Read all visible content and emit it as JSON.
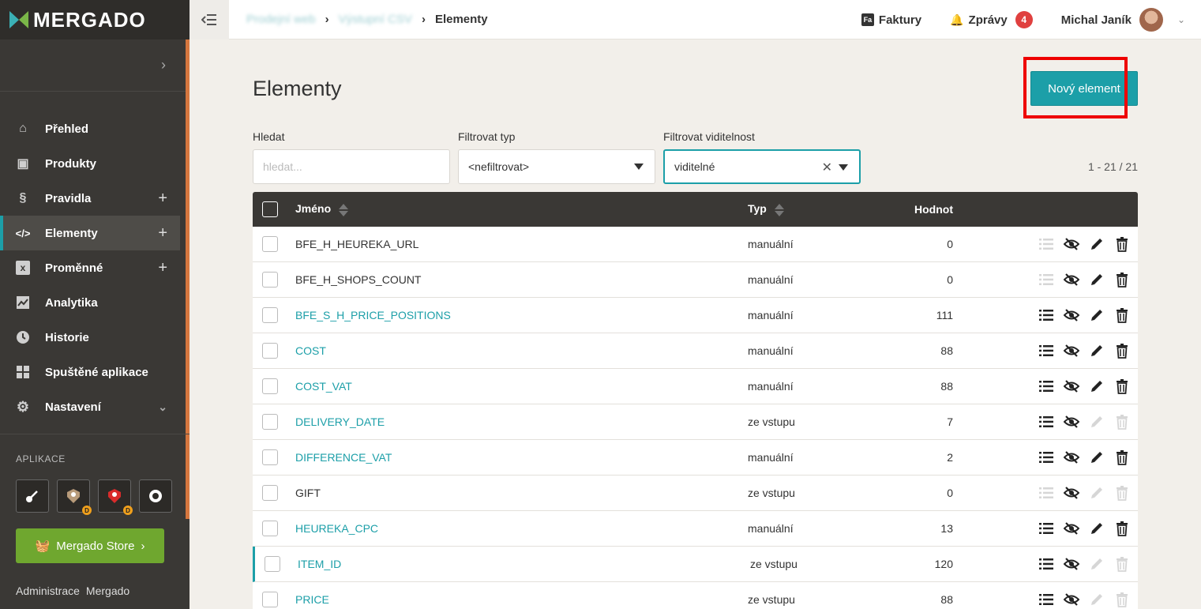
{
  "app": {
    "logo_text": "MERGADO",
    "brand_color": "#1c9fa8"
  },
  "breadcrumb": {
    "items": [
      "Prodejní web",
      "Výstupní CSV"
    ],
    "current": "Elementy"
  },
  "topbar": {
    "invoices_label": "Faktury",
    "invoices_icon": "Fa",
    "messages_label": "Zprávy",
    "messages_count": "4",
    "user_name": "Michal Janík"
  },
  "sidebar": {
    "items": [
      {
        "label": "Přehled",
        "icon": "home-icon",
        "glyph": "⌂"
      },
      {
        "label": "Produkty",
        "icon": "box-icon",
        "glyph": "▣"
      },
      {
        "label": "Pravidla",
        "icon": "section-icon",
        "glyph": "§"
      },
      {
        "label": "Elementy",
        "icon": "code-icon",
        "glyph": "</>"
      },
      {
        "label": "Proměnné",
        "icon": "variable-icon",
        "glyph": "x"
      },
      {
        "label": "Analytika",
        "icon": "chart-icon",
        "glyph": "📈"
      },
      {
        "label": "Historie",
        "icon": "clock-icon",
        "glyph": "◷"
      },
      {
        "label": "Spuštěné aplikace",
        "icon": "grid-icon",
        "glyph": "▦"
      },
      {
        "label": "Nastavení",
        "icon": "gear-icon",
        "glyph": "⚙"
      }
    ],
    "apps_title": "APLIKACE",
    "store_label": "Mergado Store",
    "bottom_links": [
      "Administrace",
      "Mergado"
    ]
  },
  "page": {
    "title": "Elementy",
    "new_button": "Nový element"
  },
  "filters": {
    "search_label": "Hledat",
    "search_placeholder": "hledat...",
    "type_label": "Filtrovat typ",
    "type_value": "<nefiltrovat>",
    "visibility_label": "Filtrovat viditelnost",
    "visibility_value": "viditelné",
    "counter": "1 - 21 / 21"
  },
  "table": {
    "headers": {
      "name": "Jméno",
      "type": "Typ",
      "value": "Hodnot"
    },
    "rows": [
      {
        "name": "BFE_H_HEUREKA_URL",
        "type": "manuální",
        "value": "0",
        "link": false
      },
      {
        "name": "BFE_H_SHOPS_COUNT",
        "type": "manuální",
        "value": "0",
        "link": false
      },
      {
        "name": "BFE_S_H_PRICE_POSITIONS",
        "type": "manuální",
        "value": "111",
        "link": true
      },
      {
        "name": "COST",
        "type": "manuální",
        "value": "88",
        "link": true
      },
      {
        "name": "COST_VAT",
        "type": "manuální",
        "value": "88",
        "link": true
      },
      {
        "name": "DELIVERY_DATE",
        "type": "ze vstupu",
        "value": "7",
        "link": true
      },
      {
        "name": "DIFFERENCE_VAT",
        "type": "manuální",
        "value": "2",
        "link": true
      },
      {
        "name": "GIFT",
        "type": "ze vstupu",
        "value": "0",
        "link": false
      },
      {
        "name": "HEUREKA_CPC",
        "type": "manuální",
        "value": "13",
        "link": true
      },
      {
        "name": "ITEM_ID",
        "type": "ze vstupu",
        "value": "120",
        "link": true
      },
      {
        "name": "PRICE",
        "type": "ze vstupu",
        "value": "88",
        "link": true
      }
    ]
  }
}
